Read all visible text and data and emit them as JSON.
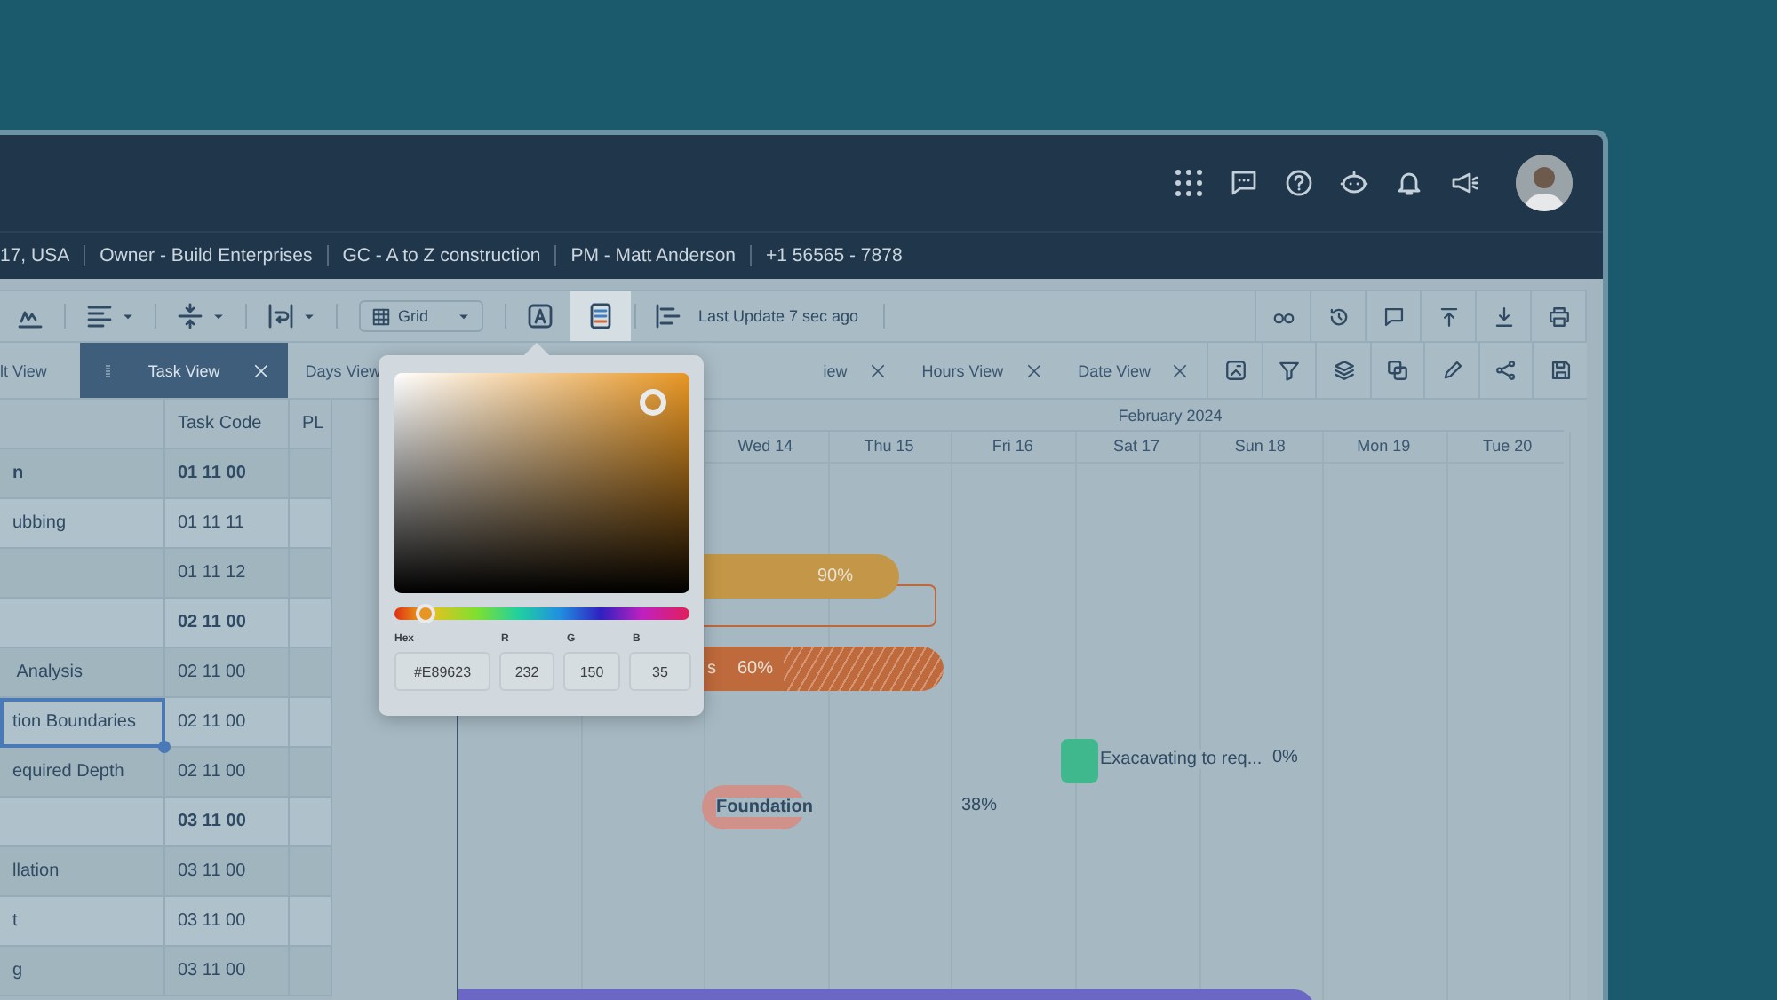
{
  "info_bar": [
    "17, USA",
    "Owner - Build Enterprises",
    "GC - A to Z construction",
    "PM -  Matt Anderson",
    "+1 56565 - 7878"
  ],
  "toolbar": {
    "grid_select": {
      "value": "Grid"
    },
    "toggle_buttons": [
      {
        "selected": false
      },
      {
        "selected": true
      }
    ],
    "status": "Last Update 7 sec ago"
  },
  "tabs": [
    {
      "label": "lt View",
      "selected": false,
      "closable": false
    },
    {
      "label": "Task View",
      "selected": true,
      "closable": true
    },
    {
      "label": "Days View",
      "selected": false,
      "closable": false
    },
    {
      "label": "iew",
      "selected": false,
      "closable": true
    },
    {
      "label": "Hours View",
      "selected": false,
      "closable": true
    },
    {
      "label": "Date View",
      "selected": false,
      "closable": true
    }
  ],
  "table": {
    "columns": [
      "Task Code",
      "PL"
    ],
    "rows": [
      {
        "name": "n",
        "code": "01 11 00",
        "group": true,
        "selected": false
      },
      {
        "name": "ubbing",
        "code": "01 11 11",
        "group": false,
        "selected": false
      },
      {
        "code": "01 11 12",
        "group": false,
        "selected": false
      },
      {
        "code": "02 11 00",
        "group": true,
        "selected": false
      },
      {
        "name": " Analysis",
        "code": "02 11 00",
        "group": false,
        "selected": false
      },
      {
        "name": "tion Boundaries",
        "code": "02 11 00",
        "group": false,
        "selected": true
      },
      {
        "name": "equired Depth",
        "code": "02 11 00",
        "group": false,
        "selected": false
      },
      {
        "code": "03 11 00",
        "group": true,
        "selected": false
      },
      {
        "name": "llation",
        "code": "03 11 00",
        "group": false,
        "selected": false
      },
      {
        "name": "t",
        "code": "03 11 00",
        "group": false,
        "selected": false
      },
      {
        "name": "g",
        "code": "03 11 00",
        "group": false,
        "selected": false
      }
    ]
  },
  "gantt": {
    "month": "February 2024",
    "days": [
      "Wed 14",
      "Thu 15",
      "Fri 16",
      "Sat 17",
      "Sun 18",
      "Mon 19",
      "Tue 20"
    ],
    "bars": [
      {
        "kind": "outline",
        "color": "#c0673e"
      },
      {
        "kind": "bar",
        "color": "#c39747",
        "progress_label": "90%"
      },
      {
        "kind": "hatched",
        "color": "#bf6a3c",
        "label": "s",
        "progress_label": "60%"
      },
      {
        "kind": "milestone",
        "color": "#3fb88d",
        "label": "Exacavating to req...",
        "progress_label": "0%"
      },
      {
        "kind": "pill",
        "color": "#cf918a",
        "label": "Foundation",
        "progress_label": "38%"
      },
      {
        "kind": "bar",
        "color": "#6a68c4"
      }
    ]
  },
  "color_picker": {
    "hex": "#E89623",
    "labels": [
      "Hex",
      "R",
      "G",
      "B"
    ],
    "r": "232",
    "g": "150",
    "b": "35",
    "hue": {
      "level": 0.1
    }
  }
}
